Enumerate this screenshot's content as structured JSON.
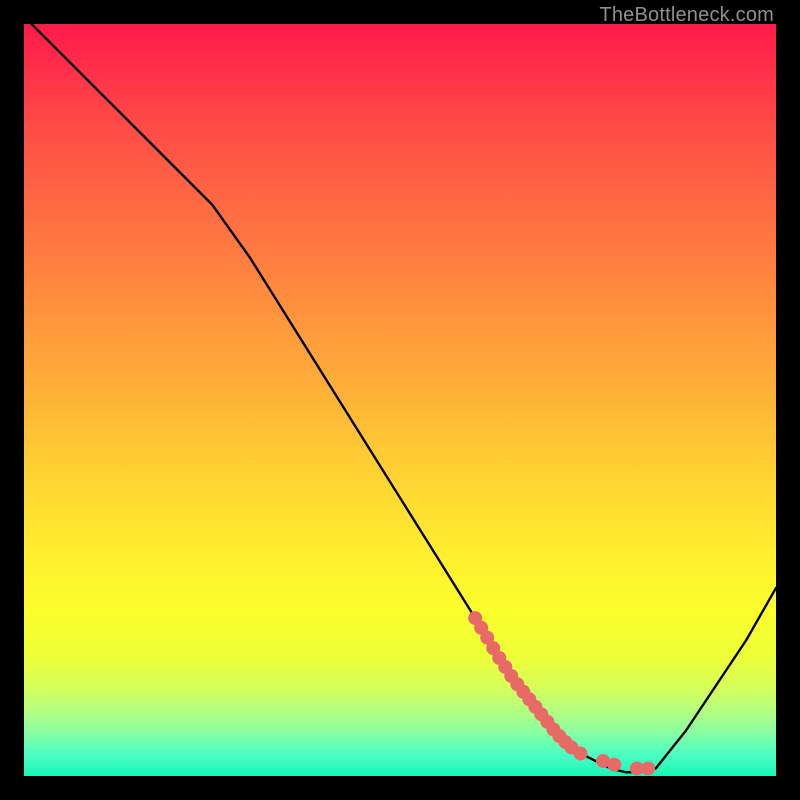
{
  "watermark": "TheBottleneck.com",
  "colors": {
    "frame": "#000000",
    "curve": "#000000",
    "marker": "#e86a66",
    "gradient_top": "#ff1a4a",
    "gradient_bottom": "#17f7b9"
  },
  "chart_data": {
    "type": "line",
    "title": "",
    "xlabel": "",
    "ylabel": "",
    "xlim": [
      0,
      100
    ],
    "ylim": [
      0,
      100
    ],
    "grid": false,
    "legend": false,
    "curve": {
      "name": "bottleneck-curve",
      "x": [
        0,
        5,
        10,
        15,
        20,
        25,
        30,
        35,
        40,
        45,
        50,
        55,
        60,
        63,
        66,
        69,
        72,
        74,
        76,
        78,
        80,
        82,
        84,
        88,
        92,
        96,
        100
      ],
      "y": [
        101,
        96,
        91,
        86,
        81,
        76,
        69,
        61,
        53,
        45,
        37,
        29,
        21,
        16,
        12,
        8,
        5,
        3,
        2,
        1,
        0.5,
        0.5,
        1,
        6,
        12,
        18,
        25
      ]
    },
    "markers": {
      "name": "highlight-dots",
      "points": [
        {
          "x": 60.0,
          "y": 21.0
        },
        {
          "x": 60.8,
          "y": 19.7
        },
        {
          "x": 61.6,
          "y": 18.4
        },
        {
          "x": 62.4,
          "y": 17.0
        },
        {
          "x": 63.2,
          "y": 15.7
        },
        {
          "x": 64.0,
          "y": 14.5
        },
        {
          "x": 64.8,
          "y": 13.3
        },
        {
          "x": 65.6,
          "y": 12.2
        },
        {
          "x": 66.4,
          "y": 11.2
        },
        {
          "x": 67.2,
          "y": 10.2
        },
        {
          "x": 68.0,
          "y": 9.2
        },
        {
          "x": 68.8,
          "y": 8.2
        },
        {
          "x": 69.6,
          "y": 7.2
        },
        {
          "x": 70.4,
          "y": 6.2
        },
        {
          "x": 71.2,
          "y": 5.3
        },
        {
          "x": 72.0,
          "y": 4.5
        },
        {
          "x": 72.8,
          "y": 3.8
        },
        {
          "x": 74.0,
          "y": 3.0
        },
        {
          "x": 77.0,
          "y": 2.0
        },
        {
          "x": 78.5,
          "y": 1.5
        },
        {
          "x": 81.5,
          "y": 1.0
        },
        {
          "x": 83.0,
          "y": 1.0
        }
      ]
    }
  }
}
